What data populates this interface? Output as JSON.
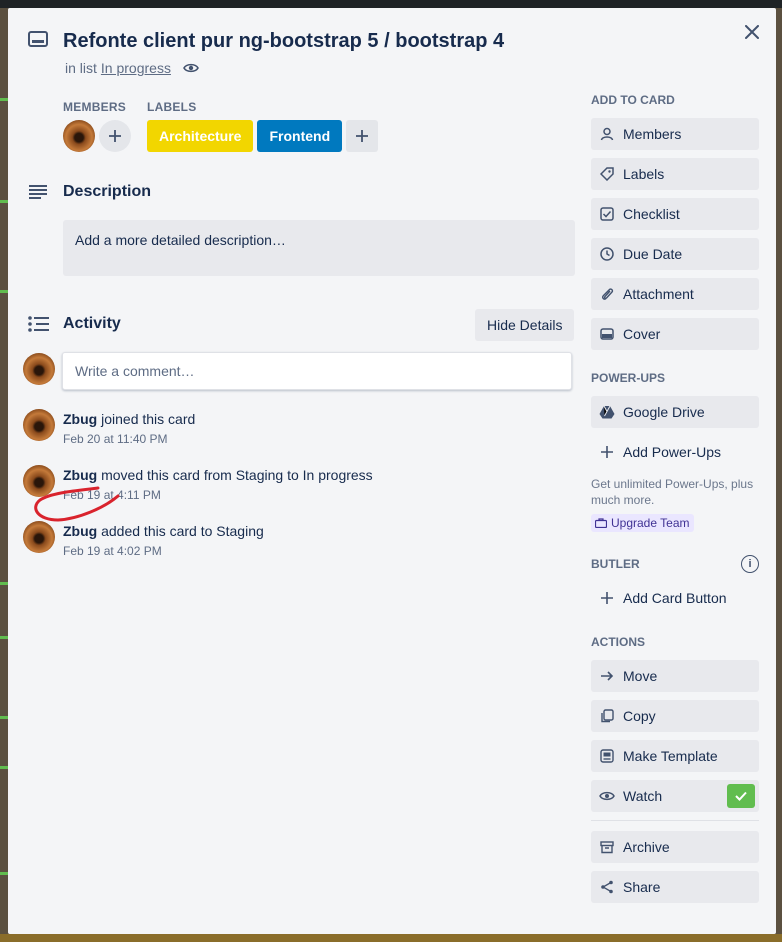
{
  "card": {
    "title": "Refonte client pur ng-bootstrap 5 / bootstrap 4",
    "in_list_prefix": "in list",
    "list_name": "In progress"
  },
  "members": {
    "label": "MEMBERS"
  },
  "labels": {
    "label": "LABELS",
    "items": [
      {
        "text": "Architecture",
        "color": "#f2d600"
      },
      {
        "text": "Frontend",
        "color": "#0079bf"
      }
    ]
  },
  "description": {
    "title": "Description",
    "placeholder": "Add a more detailed description…"
  },
  "activity": {
    "title": "Activity",
    "hide_details": "Hide Details",
    "comment_placeholder": "Write a comment…",
    "items": [
      {
        "user": "Zbug",
        "action": "joined this card",
        "time": "Feb 20 at 11:40 PM"
      },
      {
        "user": "Zbug",
        "action": "moved this card from Staging to In progress",
        "time": "Feb 19 at 4:11 PM"
      },
      {
        "user": "Zbug",
        "action": "added this card to Staging",
        "time": "Feb 19 at 4:02 PM"
      }
    ]
  },
  "sidebar": {
    "add_to_card": {
      "label": "ADD TO CARD",
      "items": [
        "Members",
        "Labels",
        "Checklist",
        "Due Date",
        "Attachment",
        "Cover"
      ]
    },
    "power_ups": {
      "label": "POWER-UPS",
      "google_drive": "Google Drive",
      "add_power_ups": "Add Power-Ups",
      "upsell": "Get unlimited Power-Ups, plus much more.",
      "upgrade": "Upgrade Team"
    },
    "butler": {
      "label": "BUTLER",
      "add_card_button": "Add Card Button"
    },
    "actions": {
      "label": "ACTIONS",
      "items": [
        "Move",
        "Copy",
        "Make Template",
        "Watch",
        "Archive",
        "Share"
      ]
    }
  },
  "colors": {
    "modal_bg": "#f4f5f7",
    "watch_check": "#61bd4f",
    "annotation_stroke": "#d9232d"
  }
}
